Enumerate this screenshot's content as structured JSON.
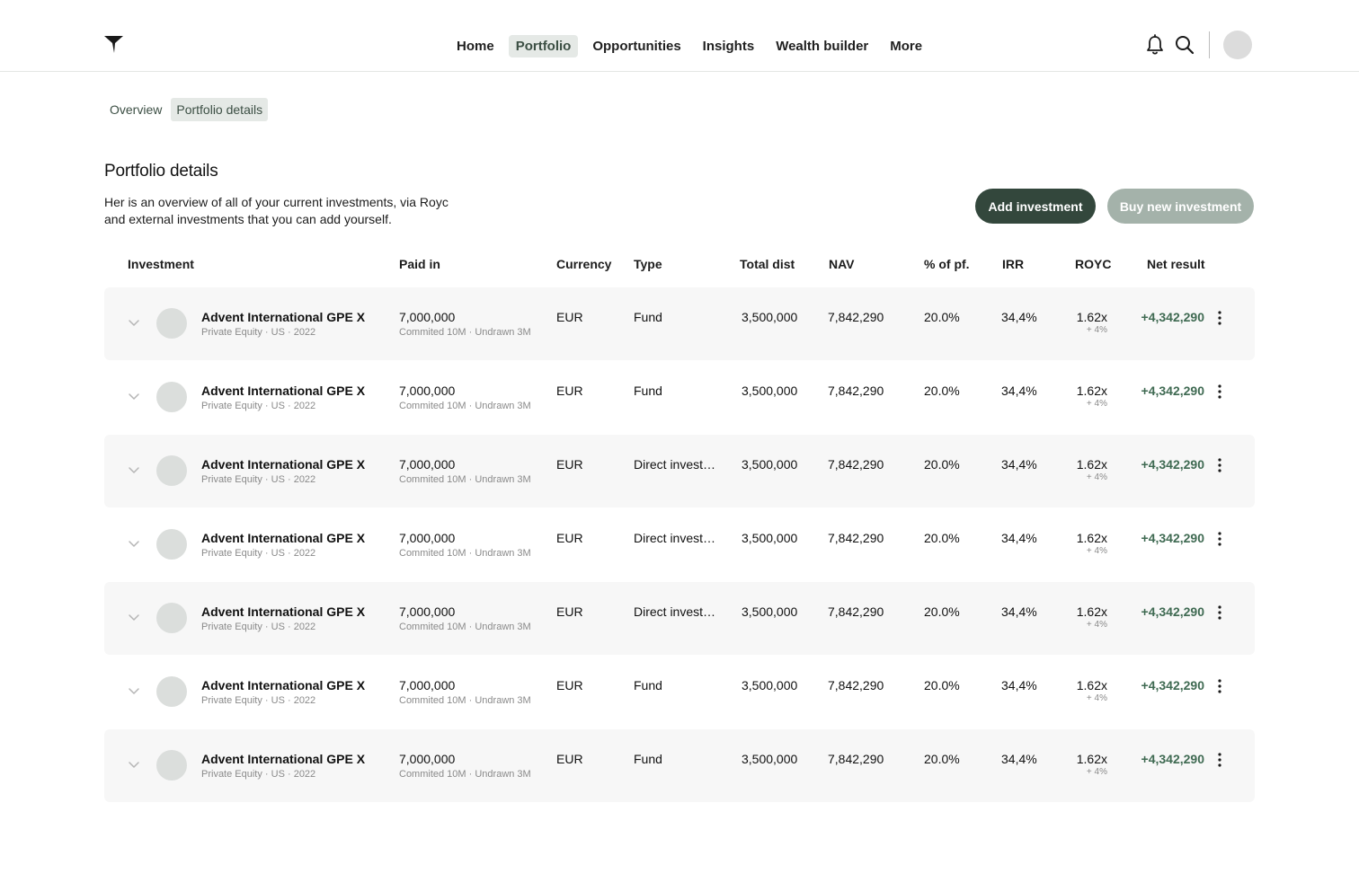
{
  "nav": {
    "items": [
      {
        "label": "Home",
        "active": false
      },
      {
        "label": "Portfolio",
        "active": true
      },
      {
        "label": "Opportunities",
        "active": false
      },
      {
        "label": "Insights",
        "active": false
      },
      {
        "label": "Wealth builder",
        "active": false
      },
      {
        "label": "More",
        "active": false
      }
    ]
  },
  "icons": {
    "logo": "logo-funnel-icon",
    "notifications": "bell-icon",
    "search": "search-icon",
    "row_expand": "chevron-down-icon",
    "row_menu": "more-vertical-icon"
  },
  "subtabs": [
    {
      "label": "Overview",
      "active": false
    },
    {
      "label": "Portfolio details",
      "active": true
    }
  ],
  "page": {
    "title": "Portfolio details",
    "description": "Her is an overview of all of your current investments, via Royc and external investments that you can add yourself."
  },
  "actions": {
    "add_label": "Add investment",
    "buy_label": "Buy new investment"
  },
  "colors": {
    "primary_button": "#33473c",
    "secondary_button": "#a4b2aa",
    "positive": "#3f6a52",
    "active_tab_bg": "#e5e9e6"
  },
  "table": {
    "headers": {
      "investment": "Investment",
      "paid_in": "Paid in",
      "currency": "Currency",
      "type": "Type",
      "total_dist": "Total dist",
      "nav": "NAV",
      "pct_pf": "% of pf.",
      "irr": "IRR",
      "royc": "ROYC",
      "net_result": "Net result"
    },
    "rows": [
      {
        "name": "Advent  International GPE X",
        "meta": "Private Equity · US · 2022",
        "paid_in": "7,000,000",
        "paid_sub": "Commited 10M  · Undrawn 3M",
        "currency": "EUR",
        "type": "Fund",
        "total_dist": "3,500,000",
        "nav": "7,842,290",
        "pct_pf": "20.0%",
        "irr": "34,4%",
        "royc": "1.62x",
        "royc_sub": "+ 4%",
        "net_result": "+4,342,290"
      },
      {
        "name": "Advent  International GPE X",
        "meta": "Private Equity · US · 2022",
        "paid_in": "7,000,000",
        "paid_sub": "Commited 10M  · Undrawn 3M",
        "currency": "EUR",
        "type": "Fund",
        "total_dist": "3,500,000",
        "nav": "7,842,290",
        "pct_pf": "20.0%",
        "irr": "34,4%",
        "royc": "1.62x",
        "royc_sub": "+ 4%",
        "net_result": "+4,342,290"
      },
      {
        "name": "Advent  International GPE X",
        "meta": "Private Equity · US · 2022",
        "paid_in": "7,000,000",
        "paid_sub": "Commited 10M  · Undrawn 3M",
        "currency": "EUR",
        "type": "Direct investm...",
        "total_dist": "3,500,000",
        "nav": "7,842,290",
        "pct_pf": "20.0%",
        "irr": "34,4%",
        "royc": "1.62x",
        "royc_sub": "+ 4%",
        "net_result": "+4,342,290"
      },
      {
        "name": "Advent  International GPE X",
        "meta": "Private Equity · US · 2022",
        "paid_in": "7,000,000",
        "paid_sub": "Commited 10M  · Undrawn 3M",
        "currency": "EUR",
        "type": "Direct investm...",
        "total_dist": "3,500,000",
        "nav": "7,842,290",
        "pct_pf": "20.0%",
        "irr": "34,4%",
        "royc": "1.62x",
        "royc_sub": "+ 4%",
        "net_result": "+4,342,290"
      },
      {
        "name": "Advent  International GPE X",
        "meta": "Private Equity · US · 2022",
        "paid_in": "7,000,000",
        "paid_sub": "Commited 10M  · Undrawn 3M",
        "currency": "EUR",
        "type": "Direct investm...",
        "total_dist": "3,500,000",
        "nav": "7,842,290",
        "pct_pf": "20.0%",
        "irr": "34,4%",
        "royc": "1.62x",
        "royc_sub": "+ 4%",
        "net_result": "+4,342,290"
      },
      {
        "name": "Advent  International GPE X",
        "meta": "Private Equity · US · 2022",
        "paid_in": "7,000,000",
        "paid_sub": "Commited 10M  · Undrawn 3M",
        "currency": "EUR",
        "type": "Fund",
        "total_dist": "3,500,000",
        "nav": "7,842,290",
        "pct_pf": "20.0%",
        "irr": "34,4%",
        "royc": "1.62x",
        "royc_sub": "+ 4%",
        "net_result": "+4,342,290"
      },
      {
        "name": "Advent  International GPE X",
        "meta": "Private Equity · US · 2022",
        "paid_in": "7,000,000",
        "paid_sub": "Commited 10M  · Undrawn 3M",
        "currency": "EUR",
        "type": "Fund",
        "total_dist": "3,500,000",
        "nav": "7,842,290",
        "pct_pf": "20.0%",
        "irr": "34,4%",
        "royc": "1.62x",
        "royc_sub": "+ 4%",
        "net_result": "+4,342,290"
      }
    ]
  }
}
